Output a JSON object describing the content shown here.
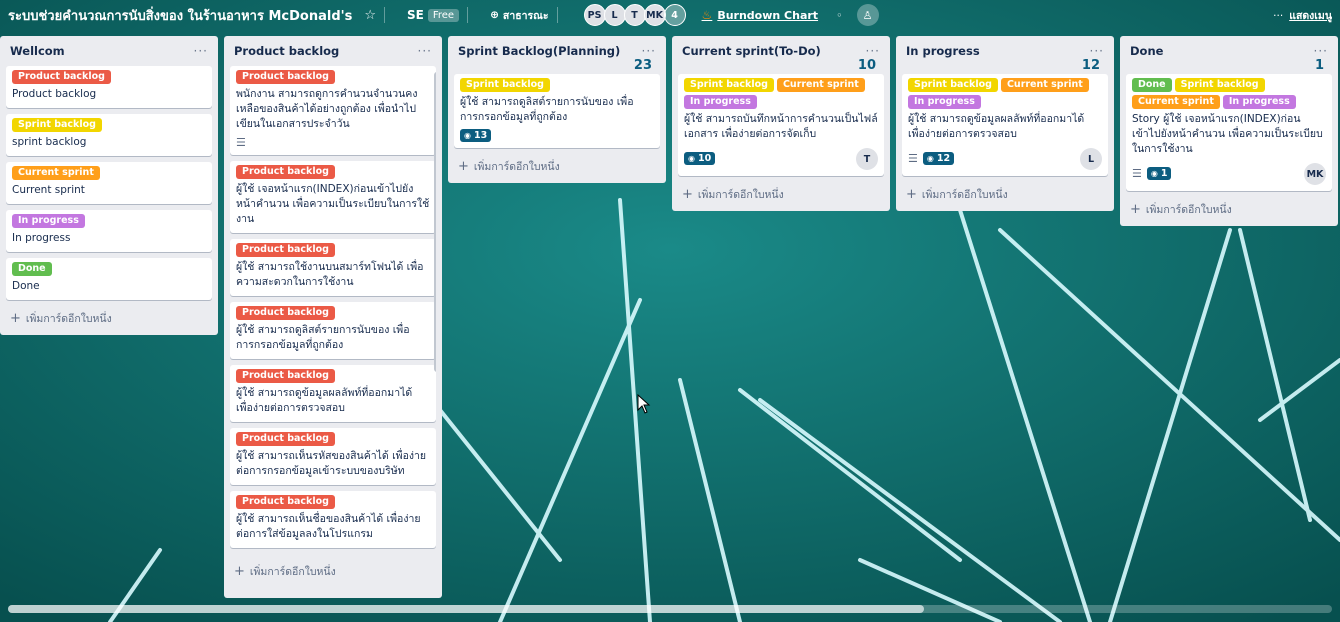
{
  "header": {
    "board_title": "ระบบช่วยคำนวณการนับสิ่งของ ในร้านอาหาร McDonald's",
    "workspace": "SE",
    "plan_badge": "Free",
    "visibility": "สาธารณะ",
    "members": [
      "PS",
      "L",
      "T",
      "MK"
    ],
    "more_members": "4",
    "powerup": "Burndown Chart",
    "show_menu": "แสดงเมนู"
  },
  "add_card_label": "เพิ่มการ์ดอีกใบหนึ่ง",
  "label_colors": {
    "Product backlog": "#eb5a46",
    "Sprint backlog": "#f2d600",
    "Current sprint": "#ff9f1a",
    "In progress": "#c377e0",
    "Done": "#61bd4f"
  },
  "lists": {
    "wellcom": {
      "title": "Wellcom",
      "cards": [
        {
          "label": "Product backlog",
          "title": "Product backlog"
        },
        {
          "label": "Sprint backlog",
          "title": "sprint backlog"
        },
        {
          "label": "Current sprint",
          "title": "Current sprint"
        },
        {
          "label": "In progress",
          "title": "In progress"
        },
        {
          "label": "Done",
          "title": "Done"
        }
      ]
    },
    "product_backlog": {
      "title": "Product backlog",
      "cards": [
        {
          "label": "Product backlog",
          "title": "พนักงาน สามารถดูการคำนวนจำนวนคงเหลือของสินค้าได้อย่างถูกต้อง เพื่อนำไปเขียนในเอกสารประจำวัน"
        },
        {
          "label": "Product backlog",
          "title": "ผู้ใช้ เจอหน้าแรก(INDEX)ก่อนเข้าไปยังหน้าคำนวน เพื่อความเป็นระเบียบในการใช้งาน"
        },
        {
          "label": "Product backlog",
          "title": "ผู้ใช้ สามารถใช้งานบนสมาร์ทโฟนได้ เพื่อความสะดวกในการใช้งาน"
        },
        {
          "label": "Product backlog",
          "title": "ผู้ใช้ สามารถดูลิสต์รายการนับของ เพื่อการกรอกข้อมูลที่ถูกต้อง"
        },
        {
          "label": "Product backlog",
          "title": "ผู้ใช้ สามารถดูข้อมูลผลลัพท์ที่ออกมาได้ เพื่อง่ายต่อการตรวจสอบ"
        },
        {
          "label": "Product backlog",
          "title": "ผู้ใช้ สามารถเห็นรหัสของสินค้าได้ เพื่อง่ายต่อการกรอกข้อมูลเข้าระบบของบริษัท"
        },
        {
          "label": "Product backlog",
          "title": "ผู้ใช้ สามารถเห็นชื่อของสินค้าได้ เพื่อง่ายต่อการใส่ข้อมูลลงในโปรแกรม"
        }
      ]
    },
    "sprint_backlog": {
      "title": "Sprint Backlog(Planning)",
      "count": "23",
      "cards": [
        {
          "label": "Sprint backlog",
          "title": "ผู้ใช้ สามารถดูลิสต์รายการนับของ เพื่อการกรอกข้อมูลที่ถูกต้อง",
          "points": "13"
        }
      ]
    },
    "current_sprint": {
      "title": "Current sprint(To-Do)",
      "count": "10",
      "cards": [
        {
          "labels": [
            "Sprint backlog",
            "Current sprint",
            "In progress"
          ],
          "title": "ผู้ใช้ สามารถบันทึกหน้าการคำนวนเป็นไฟล์เอกสาร เพื่อง่ายต่อการจัดเก็บ",
          "points": "10",
          "member": "T"
        }
      ]
    },
    "in_progress": {
      "title": "In progress",
      "count": "12",
      "cards": [
        {
          "labels": [
            "Sprint backlog",
            "Current sprint",
            "In progress"
          ],
          "title": "ผู้ใช้ สามารถดูข้อมูลผลลัพท์ที่ออกมาได้ เพื่อง่ายต่อการตรวจสอบ",
          "points": "12",
          "member": "L"
        }
      ]
    },
    "done": {
      "title": "Done",
      "count": "1",
      "cards": [
        {
          "labels": [
            "Done",
            "Sprint backlog",
            "Current sprint",
            "In progress"
          ],
          "title": "Story ผู้ใช้ เจอหน้าแรก(INDEX)ก่อนเข้าไปยังหน้าคำนวน เพื่อความเป็นระเบียบในการใช้งาน",
          "points": "1",
          "member": "MK"
        }
      ]
    }
  }
}
